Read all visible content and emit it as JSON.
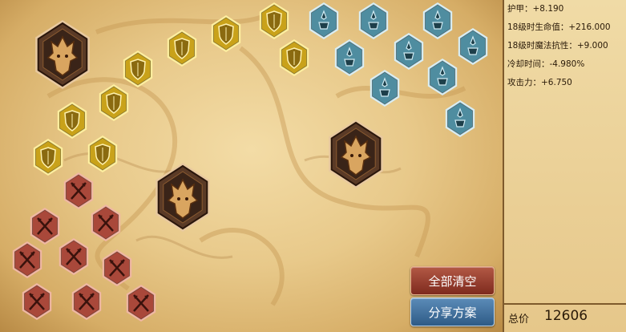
{
  "stats": [
    "护甲：+8.190",
    "18级时生命值：+216.000",
    "18级时魔法抗性：+9.000",
    "冷却时间：-4.980%",
    "攻击力：+6.750"
  ],
  "buttons": {
    "clear": "全部清空",
    "share": "分享方案"
  },
  "total": {
    "label": "总价",
    "value": "12606"
  },
  "colors": {
    "seal": "#c9a21a",
    "glyph": "#4f8da0",
    "mark": "#a9483a",
    "quintessence": "#5a3a26"
  },
  "runes": {
    "seals": {
      "icon": "shield-icon",
      "count": 9
    },
    "glyphs": {
      "icon": "glyph-icon",
      "count": 9
    },
    "marks": {
      "icon": "crossed-arrows-icon",
      "count": 9
    },
    "quintessences": {
      "icon": "dragon-icon",
      "count": 3
    }
  }
}
